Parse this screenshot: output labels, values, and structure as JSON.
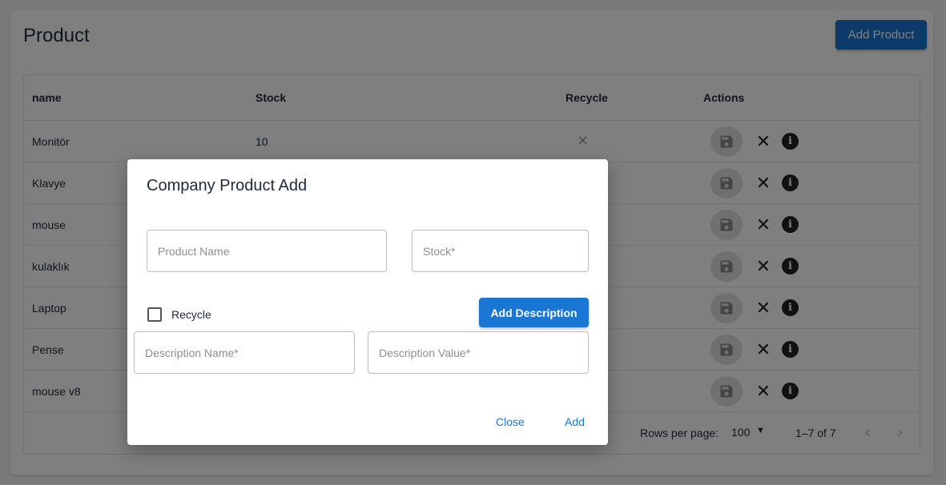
{
  "page": {
    "title": "Product",
    "add_product_label": "Add Product"
  },
  "table": {
    "headers": {
      "name": "name",
      "stock": "Stock",
      "recycle": "Recycle",
      "actions": "Actions"
    },
    "rows": [
      {
        "name": "Monitör",
        "stock": "10",
        "recycle": "✕"
      },
      {
        "name": "Klavye",
        "stock": "",
        "recycle": ""
      },
      {
        "name": "mouse",
        "stock": "",
        "recycle": ""
      },
      {
        "name": "kulaklık",
        "stock": "",
        "recycle": ""
      },
      {
        "name": "Laptop",
        "stock": "",
        "recycle": ""
      },
      {
        "name": "Pense",
        "stock": "",
        "recycle": ""
      },
      {
        "name": "mouse v8",
        "stock": "",
        "recycle": ""
      }
    ],
    "action_icons": {
      "save": "save-icon",
      "delete": "close-icon",
      "info": "info-icon"
    },
    "footer": {
      "rows_per_page_label": "Rows per page:",
      "rows_per_page_value": "100",
      "range": "1–7 of 7"
    }
  },
  "dialog": {
    "title": "Company Product Add",
    "product_name_placeholder": "Product Name",
    "stock_placeholder": "Stock*",
    "recycle_label": "Recycle",
    "recycle_checked": false,
    "add_description_label": "Add Description",
    "description_name_placeholder": "Description Name*",
    "description_value_placeholder": "Description Value*",
    "close_label": "Close",
    "add_label": "Add"
  },
  "colors": {
    "primary": "#1976d2",
    "overlay": "rgba(0,0,0,0.5)"
  }
}
